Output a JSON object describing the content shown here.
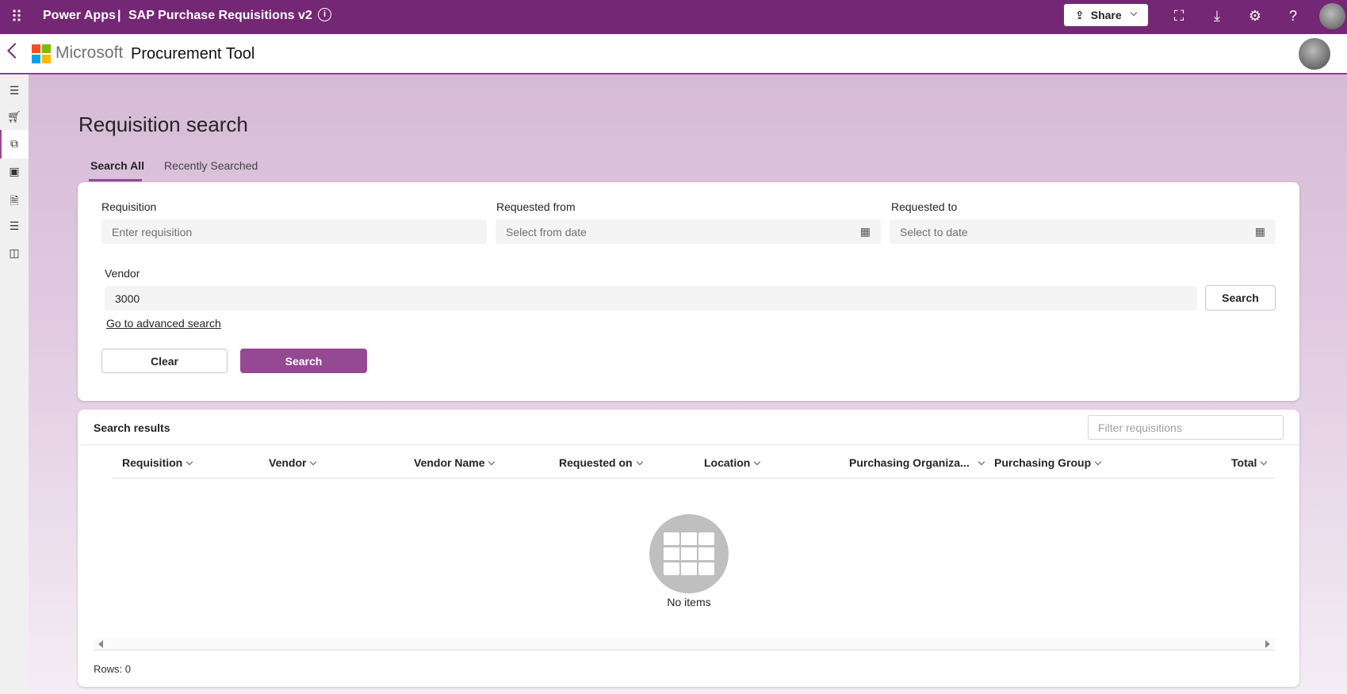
{
  "topbar": {
    "brand": "Power Apps",
    "separator": "|",
    "app_name": "SAP Purchase Requisitions v2",
    "share_label": "Share",
    "color": "#742774"
  },
  "header": {
    "company": "Microsoft",
    "title": "Procurement Tool"
  },
  "sidebar": {
    "items": [
      {
        "icon": "menu-icon"
      },
      {
        "icon": "cart-icon"
      },
      {
        "icon": "requisition-search-icon",
        "active": true
      },
      {
        "icon": "money-icon"
      },
      {
        "icon": "document-approved-icon"
      },
      {
        "icon": "document-list-icon"
      },
      {
        "icon": "calendar-clock-icon"
      }
    ]
  },
  "page": {
    "title": "Requisition search",
    "tabs": [
      {
        "label": "Search All",
        "active": true
      },
      {
        "label": "Recently Searched"
      }
    ]
  },
  "form": {
    "requisition": {
      "label": "Requisition",
      "placeholder": "Enter requisition",
      "value": ""
    },
    "from": {
      "label": "Requested from",
      "placeholder": "Select from date"
    },
    "to": {
      "label": "Requested to",
      "placeholder": "Select to date"
    },
    "vendor": {
      "label": "Vendor",
      "value": "3000",
      "search_label": "Search"
    },
    "advanced_link": "Go to advanced search",
    "clear_label": "Clear",
    "search_label": "Search",
    "accent": "#954992"
  },
  "results": {
    "title": "Search results",
    "filter_placeholder": "Filter requisitions",
    "columns": [
      "Requisition",
      "Vendor",
      "Vendor Name",
      "Requested on",
      "Location",
      "Purchasing Organiza...",
      "Purchasing Group",
      "Total"
    ],
    "empty_text": "No items",
    "rows_label": "Rows: 0"
  }
}
